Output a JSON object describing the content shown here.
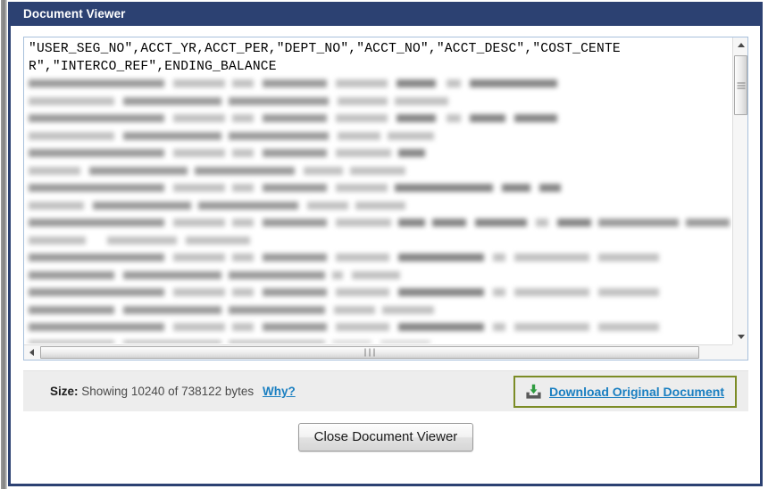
{
  "window": {
    "title": "Document Viewer"
  },
  "document_view": {
    "header_line_1": "\"USER_SEG_NO\",ACCT_YR,ACCT_PER,\"DEPT_NO\",\"ACCT_NO\",\"ACCT_DESC\",\"COST_CENTE",
    "header_line_2": "R\",\"INTERCO_REF\",ENDING_BALANCE",
    "body_state": "redacted-blurred"
  },
  "scrollbars": {
    "vertical": {
      "up_arrow": "triangle-up-icon",
      "down_arrow": "triangle-down-icon",
      "thumb_position_percent": 6,
      "thumb_size_percent": 20
    },
    "horizontal": {
      "left_arrow": "triangle-left-icon",
      "right_arrow": "triangle-right-icon",
      "thumb_position_percent": 0,
      "thumb_size_percent": 93
    }
  },
  "info_bar": {
    "size_label": "Size:",
    "size_value": "Showing 10240 of 738122 bytes",
    "why_link": "Why?",
    "download_icon": "download-tray-icon",
    "download_label": "Download Original Document"
  },
  "footer": {
    "close_label": "Close Document Viewer"
  },
  "colors": {
    "titlebar": "#2c4172",
    "link": "#1a7fc1",
    "download_border": "#7c8c26",
    "download_arrow": "#2e9b3f",
    "info_bar_bg": "#ededed",
    "textarea_border": "#a8c0dc"
  }
}
